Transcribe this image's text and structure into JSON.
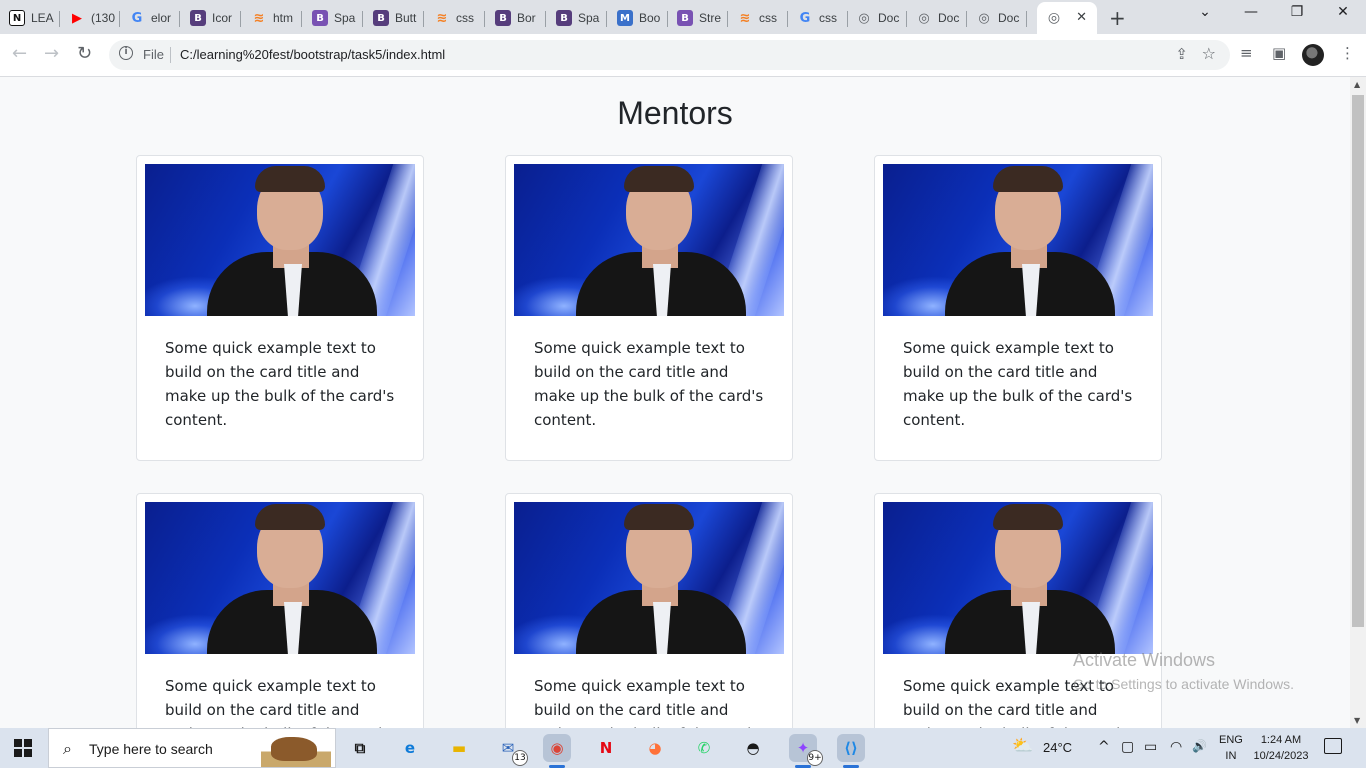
{
  "browser": {
    "tabs": [
      {
        "label": "LEA",
        "icon": "notion-icon",
        "icon_glyph": "N",
        "icon_color": "#111111"
      },
      {
        "label": "(130",
        "icon": "youtube-icon",
        "icon_glyph": "▶",
        "icon_color": "#ff0000"
      },
      {
        "label": "elor",
        "icon": "google-icon",
        "icon_glyph": "G",
        "icon_color": "#4285f4"
      },
      {
        "label": "Icor",
        "icon": "bootstrap-icon",
        "icon_glyph": "B",
        "icon_color": "#563d7c"
      },
      {
        "label": "htm",
        "icon": "stackoverflow-icon",
        "icon_glyph": "≋",
        "icon_color": "#f48024"
      },
      {
        "label": "Spa",
        "icon": "bootstrap-icon",
        "icon_glyph": "B",
        "icon_color": "#7952b3"
      },
      {
        "label": "Butt",
        "icon": "bootstrap-icon",
        "icon_glyph": "B",
        "icon_color": "#563d7c"
      },
      {
        "label": "css",
        "icon": "stackoverflow-icon",
        "icon_glyph": "≋",
        "icon_color": "#f48024"
      },
      {
        "label": "Bor",
        "icon": "bootstrap-icon",
        "icon_glyph": "B",
        "icon_color": "#563d7c"
      },
      {
        "label": "Spa",
        "icon": "bootstrap-icon",
        "icon_glyph": "B",
        "icon_color": "#563d7c"
      },
      {
        "label": "Boo",
        "icon": "mdb-icon",
        "icon_glyph": "M",
        "icon_color": "#3b71ca"
      },
      {
        "label": "Stre",
        "icon": "bootstrap-icon",
        "icon_glyph": "B",
        "icon_color": "#7952b3"
      },
      {
        "label": "css",
        "icon": "stackoverflow-icon",
        "icon_glyph": "≋",
        "icon_color": "#f48024"
      },
      {
        "label": "css",
        "icon": "google-icon",
        "icon_glyph": "G",
        "icon_color": "#4285f4"
      },
      {
        "label": "Doc",
        "icon": "globe-icon",
        "icon_glyph": "◎",
        "icon_color": "#5f6368"
      },
      {
        "label": "Doc",
        "icon": "globe-icon",
        "icon_glyph": "◎",
        "icon_color": "#5f6368"
      },
      {
        "label": "Doc",
        "icon": "globe-icon",
        "icon_glyph": "◎",
        "icon_color": "#5f6368"
      }
    ],
    "active_tab_icon": "globe-icon",
    "active_tab_close": "✕",
    "new_tab": "+",
    "window_controls": {
      "chevron": "⌄",
      "minimize": "—",
      "restore": "❐",
      "close": "✕"
    },
    "nav": {
      "back": "←",
      "forward": "→",
      "reload": "↻"
    },
    "address": {
      "scheme_label": "File",
      "url": "C:/learning%20fest/bootstrap/task5/index.html",
      "info_glyph": "i"
    },
    "toolbar_glyphs": {
      "share": "⇪",
      "star": "☆",
      "media": "≡",
      "sidepanel": "▣",
      "menu": "⋮"
    }
  },
  "page": {
    "heading": "Mentors",
    "cards": [
      {
        "text": "Some quick example text to build on the card title and make up the bulk of the card's content."
      },
      {
        "text": "Some quick example text to build on the card title and make up the bulk of the card's content."
      },
      {
        "text": "Some quick example text to build on the card title and make up the bulk of the card's content."
      },
      {
        "text": "Some quick example text to build on the card title and make up the bulk of the card's content."
      },
      {
        "text": "Some quick example text to build on the card title and make up the bulk of the card's content."
      },
      {
        "text": "Some quick example text to build on the card title and make up the bulk of the card's content."
      }
    ]
  },
  "watermark": {
    "line1": "Activate Windows",
    "line2": "Go to Settings to activate Windows."
  },
  "taskbar": {
    "search_placeholder": "Type here to search",
    "apps": [
      {
        "name": "task-view",
        "glyph": "⧉",
        "color": "#1a1a1a"
      },
      {
        "name": "edge",
        "glyph": "e",
        "color": "#0f7bd8"
      },
      {
        "name": "file-explorer",
        "glyph": "▬",
        "color": "#e8b400"
      },
      {
        "name": "mail",
        "glyph": "✉",
        "color": "#2a62b8",
        "badge": "13"
      },
      {
        "name": "chrome",
        "glyph": "◉",
        "color": "#db4437"
      },
      {
        "name": "netflix",
        "glyph": "N",
        "color": "#e50914"
      },
      {
        "name": "firefox",
        "glyph": "◕",
        "color": "#ff7139"
      },
      {
        "name": "whatsapp",
        "glyph": "✆",
        "color": "#25d366"
      },
      {
        "name": "github",
        "glyph": "◓",
        "color": "#1a1a1a"
      },
      {
        "name": "messenger",
        "glyph": "✦",
        "color": "#8e44ff",
        "badge": "9+"
      },
      {
        "name": "vscode",
        "glyph": "⟨⟩",
        "color": "#1e88e5"
      }
    ],
    "weather_temp": "24°C",
    "weather_glyph": "⛅",
    "tray_glyphs": {
      "chevron": "^",
      "meet": "▢",
      "battery": "▭",
      "wifi": "◠",
      "volume": "🔊"
    },
    "language": "ENG",
    "region": "IN",
    "time": "1:24 AM",
    "date": "10/24/2023"
  }
}
